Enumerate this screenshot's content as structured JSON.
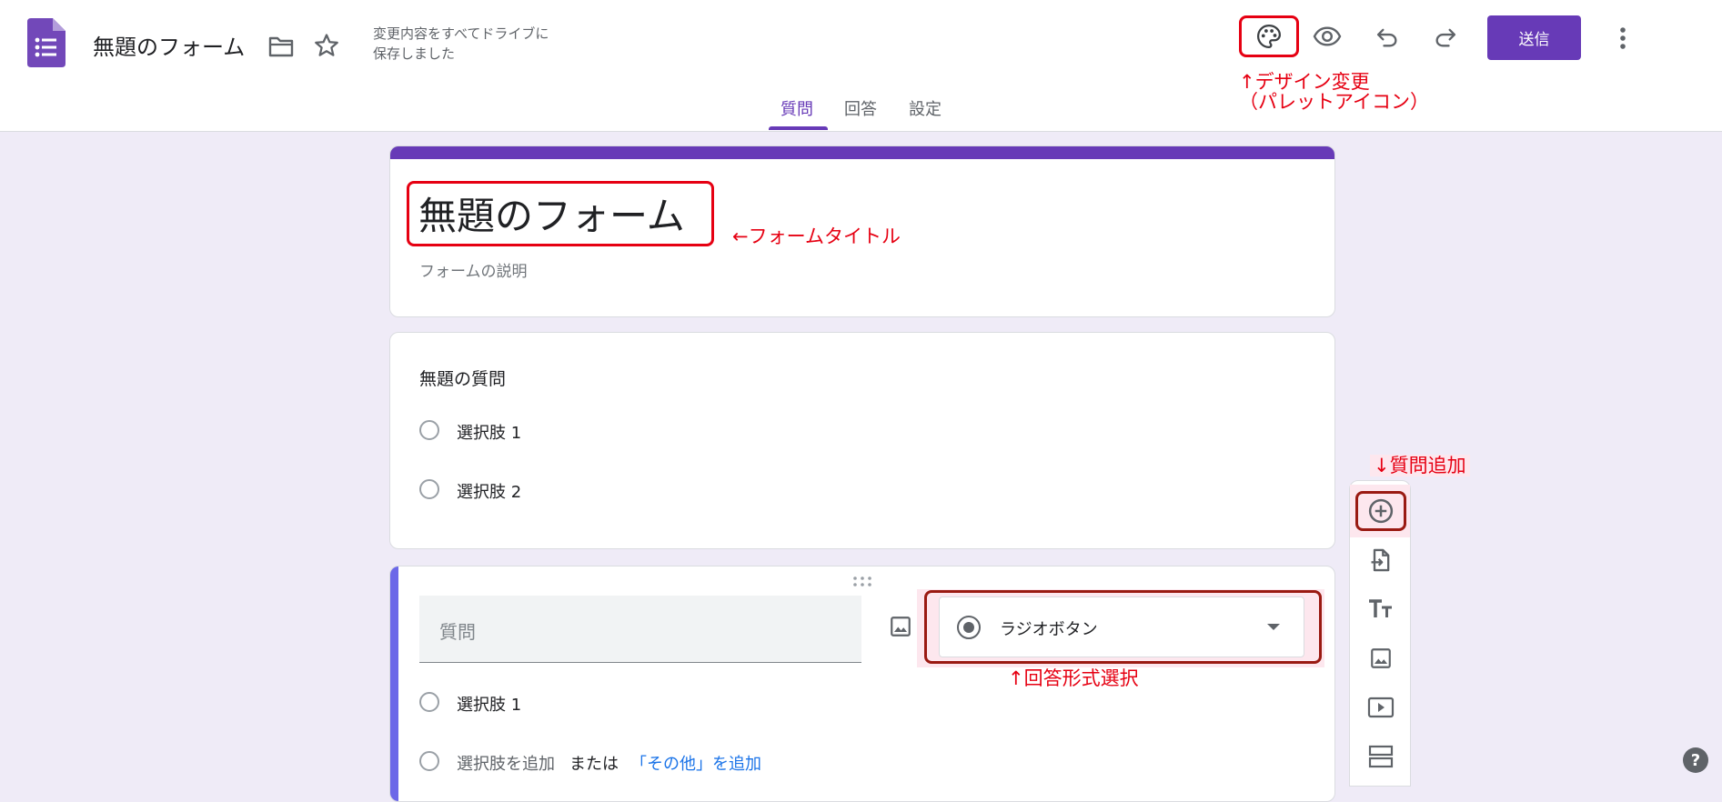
{
  "header": {
    "title": "無題のフォーム",
    "save_status_line1": "変更内容をすべてドライブに",
    "save_status_line2": "保存しました",
    "send_label": "送信",
    "tabs": [
      {
        "label": "質問",
        "active": true
      },
      {
        "label": "回答",
        "active": false
      },
      {
        "label": "設定",
        "active": false
      }
    ],
    "icons": [
      "forms-logo-icon",
      "folder-icon",
      "star-icon",
      "palette-icon",
      "eye-icon",
      "undo-icon",
      "redo-icon",
      "more-vert-icon"
    ]
  },
  "form": {
    "title": "無題のフォーム",
    "description_placeholder": "フォームの説明"
  },
  "question1": {
    "title": "無題の質問",
    "options": [
      "選択肢 1",
      "選択肢 2"
    ]
  },
  "question2": {
    "title_placeholder": "質問",
    "type_label": "ラジオボタン",
    "options": [
      "選択肢 1"
    ],
    "add_option": "選択肢を追加",
    "or_text": "または",
    "add_other": "「その他」を追加"
  },
  "annotations": {
    "palette_line1": "↑デザイン変更",
    "palette_line2": "（パレットアイコン）",
    "form_title": "←フォームタイトル",
    "add_question": "↓質問追加",
    "answer_type": "↑回答形式選択"
  },
  "toolbar": {
    "icons": [
      "add-question-icon",
      "import-questions-icon",
      "add-title-icon",
      "add-image-icon",
      "add-video-icon",
      "add-section-icon"
    ]
  },
  "help_icon_label": "?",
  "colors": {
    "accent": "#673ab7",
    "background": "#efebf7",
    "annotation_red": "#e60012",
    "active_card_bar": "#4285f4",
    "link_blue": "#1a73e8"
  }
}
